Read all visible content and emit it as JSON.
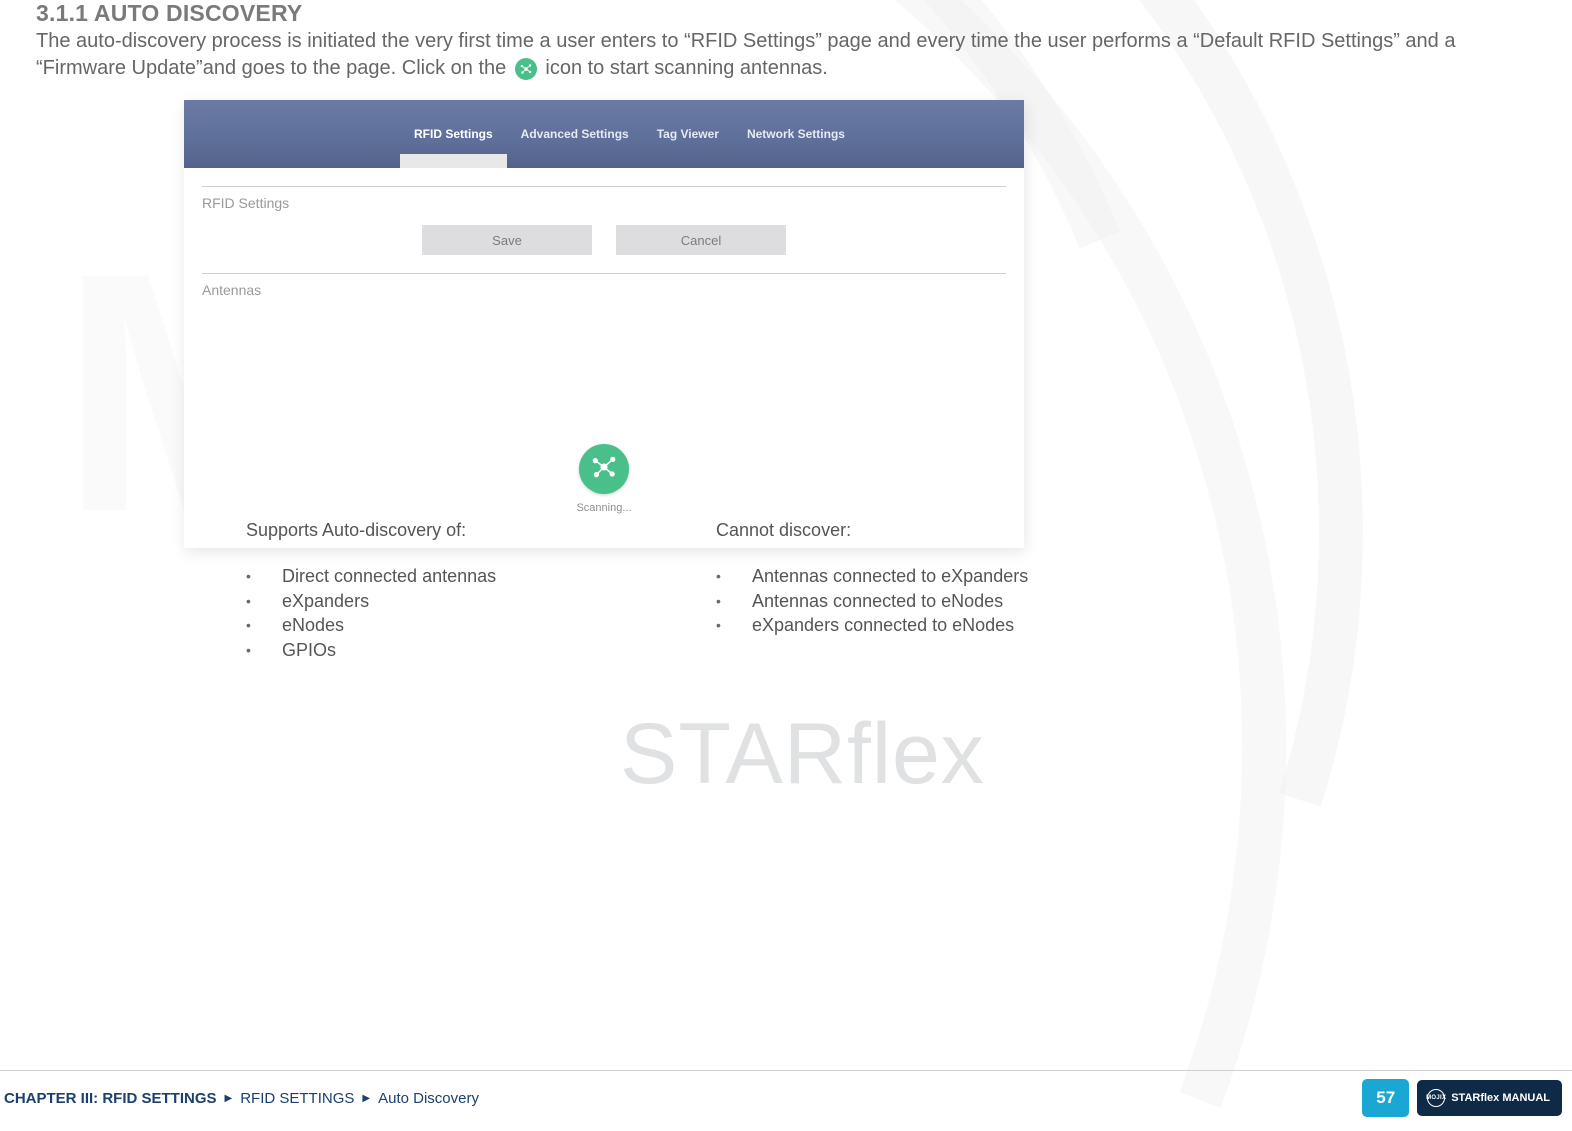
{
  "heading": "3.1.1 AUTO DISCOVERY",
  "intro": {
    "p1a": "The auto-discovery process is initiated the very first time a user enters to “RFID Settings” page and every time the user performs a “Default RFID Settings” and a “Firmware Update”and goes to the page. Click on the ",
    "p1b": " icon to start scanning antennas."
  },
  "screenshot": {
    "tabs": [
      "RFID Settings",
      "Advanced Settings",
      "Tag Viewer",
      "Network Settings"
    ],
    "section1": "RFID Settings",
    "save": "Save",
    "cancel": "Cancel",
    "section2": "Antennas",
    "scanning": "Scanning..."
  },
  "supports": {
    "title": "Supports Auto-discovery of:",
    "items": [
      "Direct connected antennas",
      "eXpanders",
      "eNodes",
      "GPIOs"
    ]
  },
  "cannot": {
    "title": "Cannot discover:",
    "items": [
      "Antennas connected to eXpanders",
      "Antennas connected to eNodes",
      "eXpanders connected to eNodes"
    ]
  },
  "watermark_text": "STARflex",
  "footer": {
    "c1": "CHAPTER III: RFID SETTINGS",
    "c2": "RFID SETTINGS",
    "c3": "Auto Discovery",
    "page": "57",
    "manual": "STARflex MANUAL",
    "logo": "MOJIX"
  }
}
